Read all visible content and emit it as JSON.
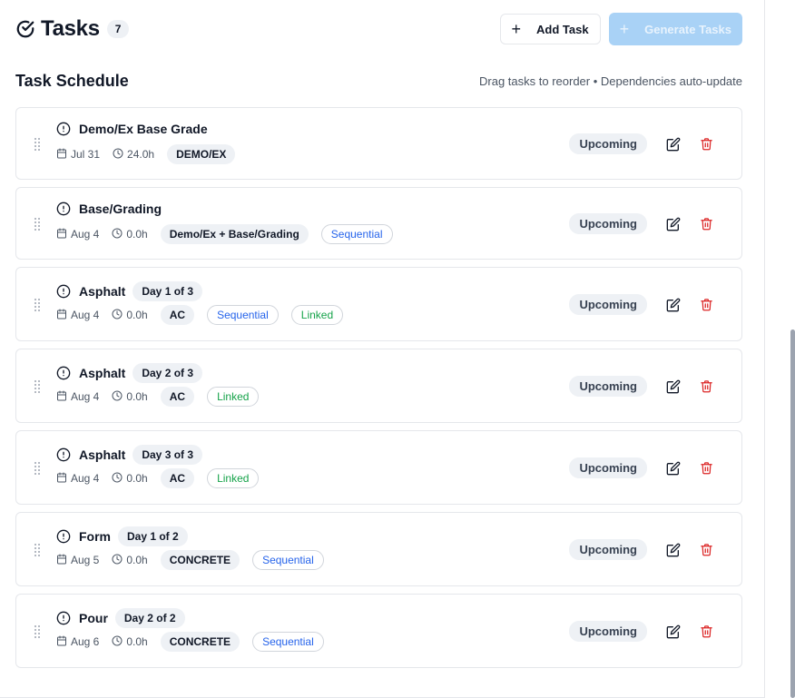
{
  "header": {
    "title": "Tasks",
    "count": "7",
    "add_label": "Add Task",
    "generate_label": "Generate Tasks"
  },
  "schedule": {
    "title": "Task Schedule",
    "hint": "Drag tasks to reorder • Dependencies auto-update"
  },
  "tasks": [
    {
      "name": "Demo/Ex Base Grade",
      "day": "",
      "date": "Jul 31",
      "hours": "24.0h",
      "trade": "DEMO/EX",
      "sequential": "",
      "linked": "",
      "status": "Upcoming"
    },
    {
      "name": "Base/Grading",
      "day": "",
      "date": "Aug 4",
      "hours": "0.0h",
      "trade": "Demo/Ex + Base/Grading",
      "sequential": "Sequential",
      "linked": "",
      "status": "Upcoming"
    },
    {
      "name": "Asphalt",
      "day": "Day 1 of 3",
      "date": "Aug 4",
      "hours": "0.0h",
      "trade": "AC",
      "sequential": "Sequential",
      "linked": "Linked",
      "status": "Upcoming"
    },
    {
      "name": "Asphalt",
      "day": "Day 2 of 3",
      "date": "Aug 4",
      "hours": "0.0h",
      "trade": "AC",
      "sequential": "",
      "linked": "Linked",
      "status": "Upcoming"
    },
    {
      "name": "Asphalt",
      "day": "Day 3 of 3",
      "date": "Aug 4",
      "hours": "0.0h",
      "trade": "AC",
      "sequential": "",
      "linked": "Linked",
      "status": "Upcoming"
    },
    {
      "name": "Form",
      "day": "Day 1 of 2",
      "date": "Aug 5",
      "hours": "0.0h",
      "trade": "CONCRETE",
      "sequential": "Sequential",
      "linked": "",
      "status": "Upcoming"
    },
    {
      "name": "Pour",
      "day": "Day 2 of 2",
      "date": "Aug 6",
      "hours": "0.0h",
      "trade": "CONCRETE",
      "sequential": "Sequential",
      "linked": "",
      "status": "Upcoming"
    }
  ],
  "colors": {
    "accent": "#a9d2f6",
    "sequential": "#2563eb",
    "linked": "#16a34a",
    "delete": "#dc2626"
  },
  "icons": [
    "check-circle-icon",
    "plus-icon",
    "drag-handle-icon",
    "alert-circle-icon",
    "calendar-icon",
    "clock-icon",
    "edit-icon",
    "trash-icon"
  ]
}
